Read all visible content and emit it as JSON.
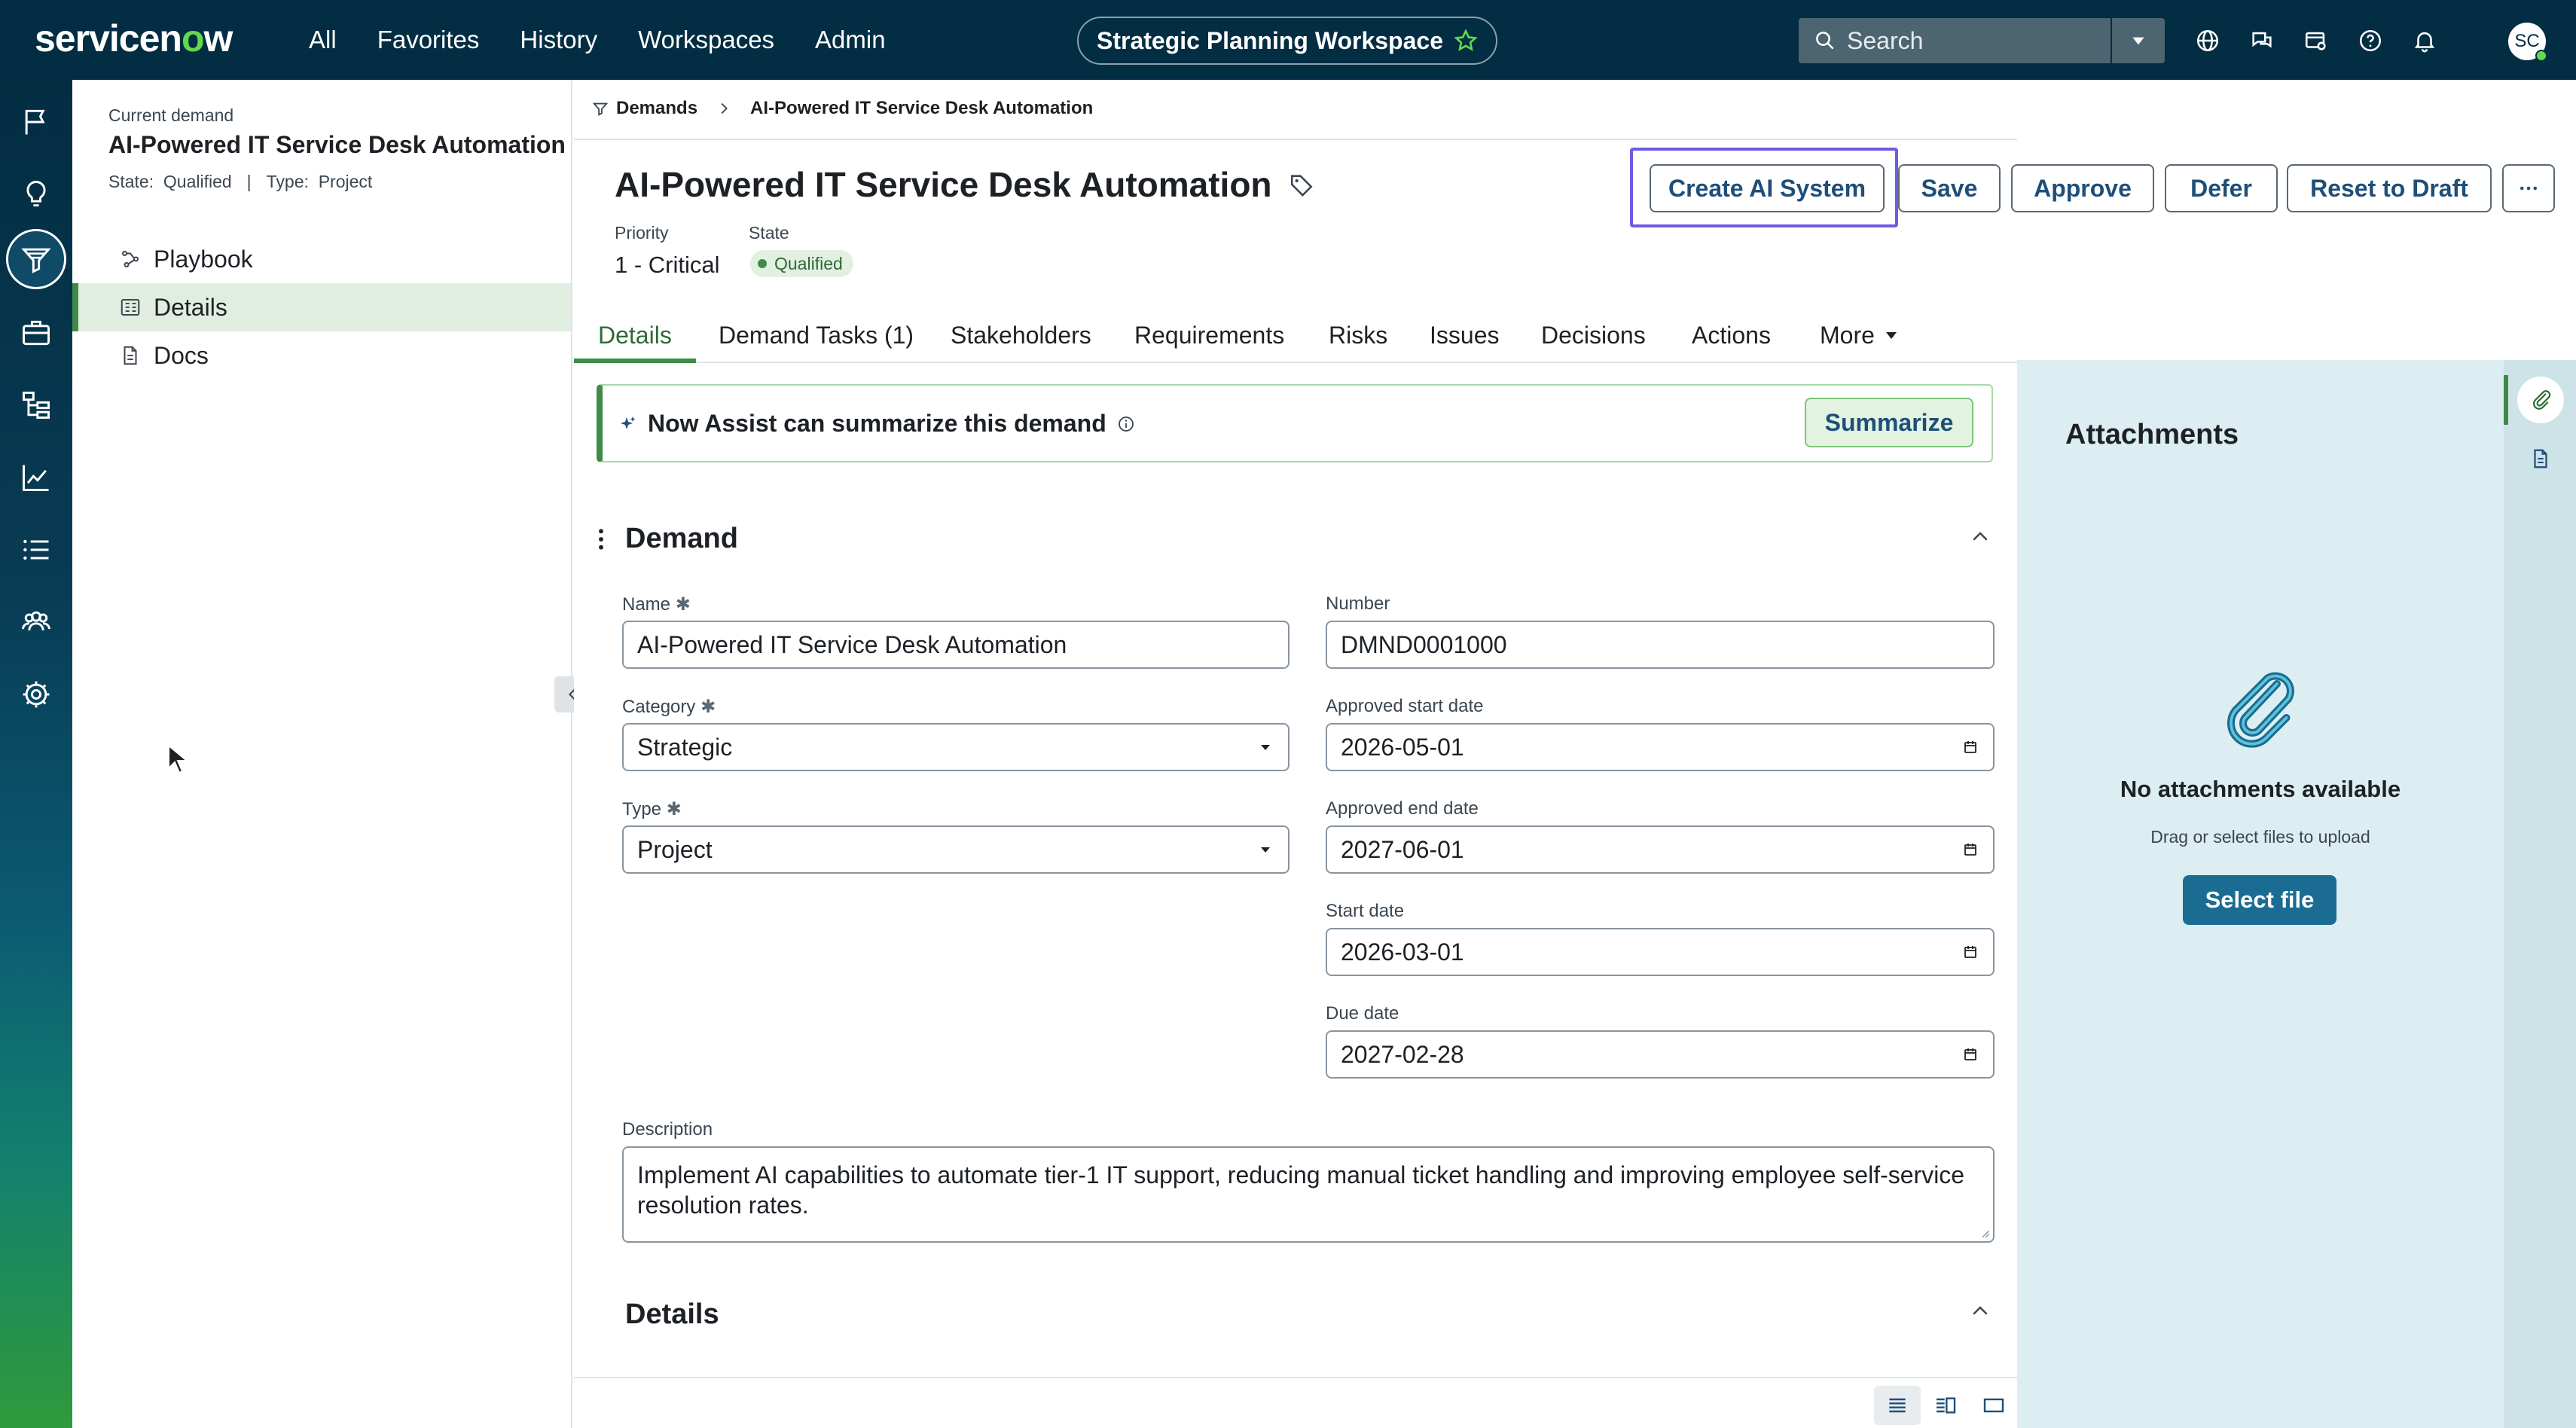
{
  "topnav": {
    "logo_text_a": "servicen",
    "logo_text_o": "o",
    "logo_text_b": "w",
    "links": [
      "All",
      "Favorites",
      "History",
      "Workspaces",
      "Admin"
    ],
    "workspace_title": "Strategic Planning Workspace",
    "search_placeholder": "Search",
    "avatar_initials": "SC"
  },
  "context": {
    "caption": "Current demand",
    "title": "AI-Powered IT Service Desk Automation",
    "state_label": "State:",
    "state_value": "Qualified",
    "separator": "|",
    "type_label": "Type:",
    "type_value": "Project",
    "nav": [
      {
        "label": "Playbook",
        "icon": "playbook-icon"
      },
      {
        "label": "Details",
        "icon": "details-icon"
      },
      {
        "label": "Docs",
        "icon": "docs-icon"
      }
    ]
  },
  "breadcrumb": {
    "root": "Demands",
    "current": "AI-Powered IT Service Desk Automation"
  },
  "record": {
    "title": "AI-Powered IT Service Desk Automation",
    "priority_label": "Priority",
    "priority_value": "1 - Critical",
    "state_label": "State",
    "state_value": "Qualified"
  },
  "actions": {
    "create_ai": "Create AI System",
    "save": "Save",
    "approve": "Approve",
    "defer": "Defer",
    "reset": "Reset to Draft"
  },
  "tabs": [
    "Details",
    "Demand Tasks (1)",
    "Stakeholders",
    "Requirements",
    "Risks",
    "Issues",
    "Decisions",
    "Actions",
    "More"
  ],
  "assist": {
    "text": "Now Assist can summarize this demand",
    "button": "Summarize"
  },
  "demand_section": {
    "title": "Demand",
    "name_label": "Name",
    "name_value": "AI-Powered IT Service Desk Automation",
    "number_label": "Number",
    "number_value": "DMND0001000",
    "category_label": "Category",
    "category_value": "Strategic",
    "approved_start_label": "Approved start date",
    "approved_start_value": "2026-05-01",
    "type_label": "Type",
    "type_value": "Project",
    "approved_end_label": "Approved end date",
    "approved_end_value": "2027-06-01",
    "start_label": "Start date",
    "start_value": "2026-03-01",
    "due_label": "Due date",
    "due_value": "2027-02-28",
    "description_label": "Description",
    "description_value": "Implement AI capabilities to automate tier-1 IT support, reducing manual ticket handling and improving employee self-service resolution rates."
  },
  "details_section": {
    "title": "Details"
  },
  "attachments": {
    "title": "Attachments",
    "empty_title": "No attachments available",
    "hint": "Drag or select files to upload",
    "button": "Select file"
  },
  "colors": {
    "nav_bg": "#032d42",
    "accent_green": "#3f8b47",
    "focus_outline": "#6b5de3",
    "button_text": "#1f4e79",
    "attach_bg": "#dceef2"
  }
}
